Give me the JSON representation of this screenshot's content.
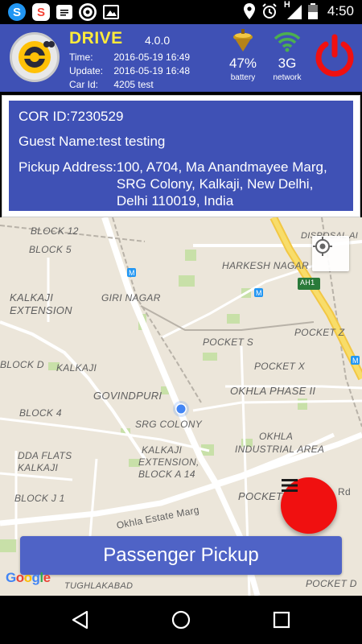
{
  "status_bar": {
    "time": "4:50",
    "network_letter": "H",
    "icons": [
      "skype-icon",
      "app-s-icon",
      "message-icon",
      "drive-app-icon",
      "image-icon",
      "location-icon",
      "alarm-icon",
      "signal-icon",
      "battery-icon"
    ]
  },
  "header": {
    "app_name": "DRIVE",
    "version": "4.0.0",
    "time_label": "Time:",
    "time_value": "2016-05-19 16:49",
    "update_label": "Update:",
    "update_value": "2016-05-19 16:48",
    "carid_label": "Car Id:",
    "carid_value": "4205 test",
    "battery_value": "47%",
    "battery_caption": "battery",
    "network_value": "3G",
    "network_caption": "network",
    "colors": {
      "bar": "#3f51b5",
      "title": "#ffeb3b",
      "power": "#f01010"
    }
  },
  "booking": {
    "cor_id": "COR ID:7230529",
    "guest_name": "Guest Name:test testing",
    "pickup_label": "Pickup Address:",
    "pickup_address": "100, A704, Ma Anandmayee Marg, SRG Colony, Kalkaji, New Delhi, Delhi 110019, India"
  },
  "map": {
    "labels": {
      "block12": "BLOCK 12",
      "block5": "BLOCK 5",
      "kalkaji_ext_1": "KALKAJI",
      "kalkaji_ext_2": "EXTENSION",
      "giri_nagar": "GIRI NAGAR",
      "harkesh_nagar": "HARKESH NAGAR",
      "disposal": "DISPOSAL AI",
      "ah1": "AH1",
      "pocket_z": "POCKET Z",
      "pocket_s": "POCKET S",
      "pocket_x": "POCKET X",
      "block_d": "BLOCK D",
      "kalkaji": "KALKAJI",
      "govindpuri": "GOVINDPURI",
      "okhla_phase": "OKHLA PHASE II",
      "block4": "BLOCK 4",
      "srg_colony": "SRG COLONY",
      "okhla_ind_1": "OKHLA",
      "okhla_ind_2": "INDUSTRIAL AREA",
      "dda_1": "DDA FLATS",
      "dda_2": "KALKAJI",
      "kx_1": "KALKAJI",
      "kx_2": "EXTENSION,",
      "kx_3": "BLOCK A 14",
      "pocket_short": "POCKET",
      "rd": "Rd",
      "block_j1": "BLOCK J 1",
      "okhla_estate": "Okhla Estate Marg",
      "tughlakabad": "TUGHLAKABAD",
      "pocket_d": "POCKET D"
    },
    "google_logo": "Google",
    "metro_symbol": "M",
    "pickup_button": "Passenger Pickup"
  },
  "nav": {
    "icons": [
      "back-icon",
      "home-icon",
      "recents-icon"
    ]
  }
}
